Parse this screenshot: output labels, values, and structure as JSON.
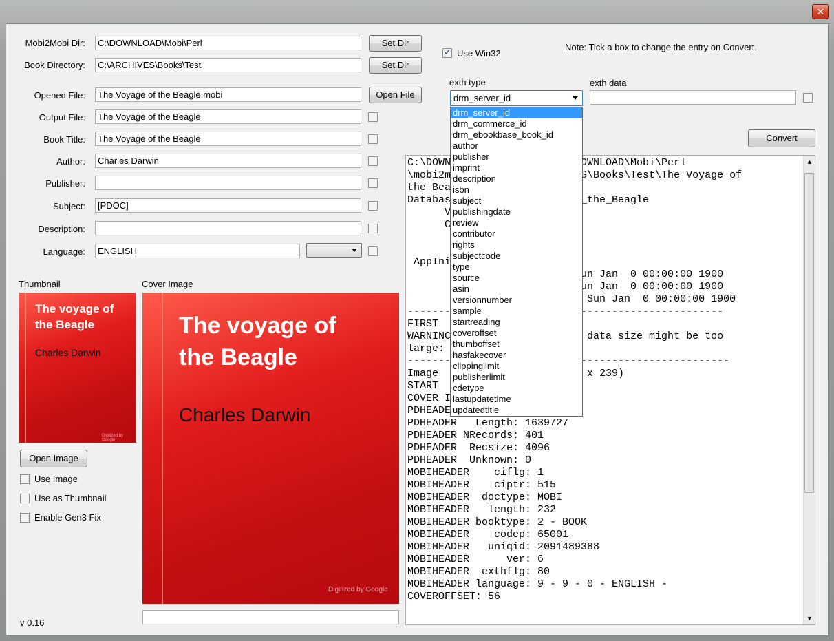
{
  "window": {
    "close_glyph": "✕"
  },
  "fields": {
    "mobi_dir_label": "Mobi2Mobi Dir:",
    "mobi_dir_value": "C:\\DOWNLOAD\\Mobi\\Perl",
    "book_dir_label": "Book Directory:",
    "book_dir_value": "C:\\ARCHIVES\\Books\\Test",
    "opened_file_label": "Opened File:",
    "opened_file_value": "The Voyage of the Beagle.mobi",
    "output_file_label": "Output File:",
    "output_file_value": "The Voyage of the Beagle",
    "book_title_label": "Book Title:",
    "book_title_value": "The Voyage of the Beagle",
    "author_label": "Author:",
    "author_value": "Charles Darwin",
    "publisher_label": "Publisher:",
    "publisher_value": "",
    "subject_label": "Subject:",
    "subject_value": "[PDOC]",
    "description_label": "Description:",
    "description_value": "",
    "language_label": "Language:",
    "language_value": "ENGLISH"
  },
  "buttons": {
    "set_dir": "Set Dir",
    "open_file": "Open File",
    "open_image": "Open Image",
    "convert": "Convert"
  },
  "options": {
    "use_win32": "Use Win32",
    "use_win32_checked": true,
    "note": "Note: Tick a box to change the entry on Convert.",
    "use_image": "Use Image",
    "use_as_thumbnail": "Use as Thumbnail",
    "enable_gen3_fix": "Enable Gen3 Fix"
  },
  "exth": {
    "type_label": "exth type",
    "data_label": "exth data",
    "selected": "drm_server_id",
    "data_value": "",
    "items": [
      "drm_server_id",
      "drm_commerce_id",
      "drm_ebookbase_book_id",
      "author",
      "publisher",
      "imprint",
      "description",
      "isbn",
      "subject",
      "publishingdate",
      "review",
      "contributor",
      "rights",
      "subjectcode",
      "type",
      "source",
      "asin",
      "versionnumber",
      "sample",
      "startreading",
      "coveroffset",
      "thumboffset",
      "hasfakecover",
      "clippinglimit",
      "publisherlimit",
      "cdetype",
      "lastupdatetime",
      "updatedtitle"
    ]
  },
  "images": {
    "thumbnail_label": "Thumbnail",
    "cover_label": "Cover Image",
    "book_title_line1": "The voyage of",
    "book_title_line2": "the Beagle",
    "book_author": "Charles Darwin",
    "digitized": "Digitized by Google",
    "cover_caption": ""
  },
  "log_lines": [
    "C:\\DOWN                    DOWNLOAD\\Mobi\\Perl",
    "\\mobi2m                   VES\\Books\\Test\\The Voyage of",
    "the Bea",
    "Databas                  _of_the_Beagle",
    "      V",
    "      C",
    "",
    "",
    " AppIni",
    "                         - Sun Jan  0 00:00:00 1900",
    "                         - Sun Jan  0 00:00:00 1900",
    "       k                 ) - Sun Jan  0 00:00:00 1900",
    "--------                 --------------------------",
    "FIRST",
    "WARNINC                  age data size might be too",
    "large:",
    "--------                 ---------------------------",
    "Image                    322 x 239)",
    "START",
    "COVER IMAGE INDEX: 406",
    "PDHEADER  Version: 2",
    "PDHEADER   Length: 1639727",
    "PDHEADER NRecords: 401",
    "PDHEADER  Recsize: 4096",
    "PDHEADER  Unknown: 0",
    "MOBIHEADER    ciflg: 1",
    "MOBIHEADER    ciptr: 515",
    "MOBIHEADER  doctype: MOBI",
    "MOBIHEADER   length: 232",
    "MOBIHEADER booktype: 2 - BOOK",
    "MOBIHEADER    codep: 65001",
    "MOBIHEADER   uniqid: 2091489388",
    "MOBIHEADER      ver: 6",
    "MOBIHEADER  exthflg: 80",
    "MOBIHEADER language: 9 - 9 - 0 - ENGLISH -",
    "COVEROFFSET: 56"
  ],
  "version": "v 0.16"
}
